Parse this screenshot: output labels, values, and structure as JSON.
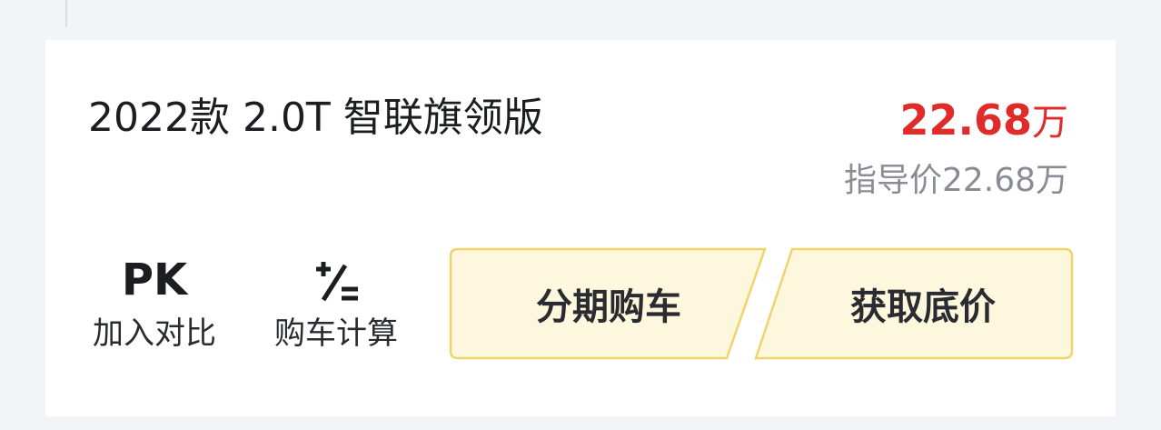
{
  "card": {
    "title": "2022款 2.0T 智联旗领版",
    "price": {
      "value": "22.68",
      "unit": "万",
      "guide": "指导价22.68万",
      "color": "#e02b2b"
    }
  },
  "actions": {
    "pk": {
      "icon_text": "PK",
      "label": "加入对比"
    },
    "calculator": {
      "icon": "plus-slash-equals-icon",
      "label": "购车计算"
    },
    "loan_button": {
      "label": "分期购车"
    },
    "price_button": {
      "label": "获取底价"
    },
    "button_fill": "#fdf8dd",
    "button_border": "#f0d46b"
  }
}
